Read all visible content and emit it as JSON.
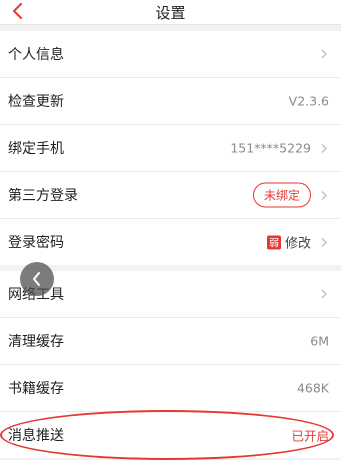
{
  "header": {
    "title": "设置"
  },
  "group1": [
    {
      "label": "个人信息",
      "value": "",
      "chevron": true
    },
    {
      "label": "检查更新",
      "value": "V2.3.6",
      "chevron": false
    },
    {
      "label": "绑定手机",
      "value": "151****5229",
      "chevron": true
    },
    {
      "label": "第三方登录",
      "value": "未绑定",
      "chevron": true
    },
    {
      "label": "登录密码",
      "value": "修改",
      "badge": "弱",
      "chevron": true
    }
  ],
  "group2": [
    {
      "label": "网络工具",
      "value": "",
      "chevron": true
    },
    {
      "label": "清理缓存",
      "value": "6M",
      "chevron": false
    },
    {
      "label": "书籍缓存",
      "value": "468K",
      "chevron": false
    },
    {
      "label": "消息推送",
      "value": "已开启",
      "chevron": false
    }
  ],
  "colors": {
    "accent": "#e53a34",
    "muted": "#8a8a8a",
    "background": "#f2f2f2"
  }
}
